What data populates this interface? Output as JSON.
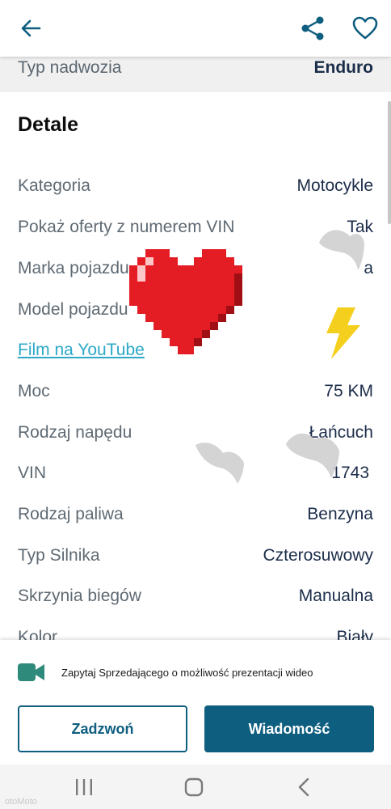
{
  "header": {
    "back_icon": "arrow-left-icon",
    "share_icon": "share-icon",
    "favorite_icon": "heart-outline-icon"
  },
  "previous_row": {
    "label": "Typ nadwozia",
    "value": "Enduro"
  },
  "section": {
    "title": "Detale"
  },
  "details": [
    {
      "label": "Kategoria",
      "value": "Motocykle"
    },
    {
      "label": "Pokaż oferty z numerem VIN",
      "value": "Tak"
    },
    {
      "label": "Marka pojazdu",
      "value": "a"
    },
    {
      "label": "Model pojazdu",
      "value": ""
    },
    {
      "label": "Film na YouTube",
      "value": "",
      "link": true
    },
    {
      "label": "Moc",
      "value": "75 KM"
    },
    {
      "label": "Rodzaj napędu",
      "value": "Łańcuch"
    },
    {
      "label": "VIN",
      "value": "1743"
    },
    {
      "label": "Rodzaj paliwa",
      "value": "Benzyna"
    },
    {
      "label": "Typ Silnika",
      "value": "Czterosuwowy"
    },
    {
      "label": "Skrzynia biegów",
      "value": "Manualna"
    },
    {
      "label": "Kolor",
      "value": "Biały"
    }
  ],
  "video_request": {
    "icon": "video-camera-icon",
    "text": "Zapytaj Sprzedającego o możliwość prezentacji wideo"
  },
  "actions": {
    "call_label": "Zadzwoń",
    "message_label": "Wiadomość"
  },
  "navbar": {
    "recent_icon": "recent-apps-icon",
    "home_icon": "home-icon",
    "back_icon": "nav-back-icon",
    "watermark": "otoMoto"
  },
  "colors": {
    "primary": "#0e5e7f",
    "link": "#2ca9c8",
    "heart": "#e41c24",
    "bolt": "#f5cf1e"
  }
}
